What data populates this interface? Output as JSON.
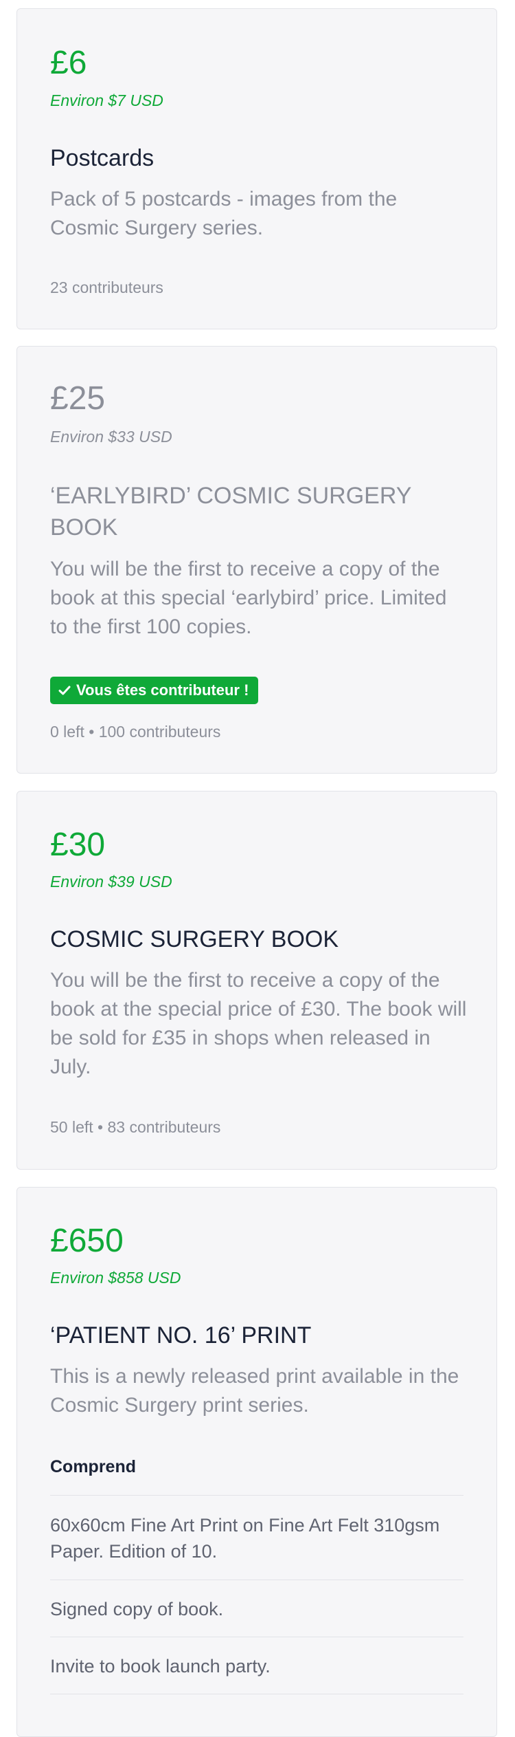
{
  "rewards": [
    {
      "price": "£6",
      "usd": "Environ $7 USD",
      "title": "Postcards",
      "description": "Pack of 5 postcards - images from the Cosmic Surgery series.",
      "meta": "23 contributeurs"
    },
    {
      "price": "£25",
      "usd": "Environ $33 USD",
      "title": "‘EARLYBIRD’ COSMIC SURGERY BOOK",
      "description": "You will be the first to receive a copy of the book at this special ‘earlybird’ price. Limited to the first 100 copies.",
      "badge": "Vous êtes contributeur !",
      "badge_icon": "check-icon",
      "meta": "0 left • 100 contributeurs"
    },
    {
      "price": "£30",
      "usd": "Environ $39 USD",
      "title": "COSMIC SURGERY BOOK",
      "description": "You will be the first to receive a copy of the book at the special price of £30. The book will be sold for £35 in shops when released in July.",
      "meta": "50 left • 83 contributeurs"
    },
    {
      "price": "£650",
      "usd": "Environ $858 USD",
      "title": "‘PATIENT NO. 16’ PRINT",
      "description": "This is a newly released print available in the Cosmic Surgery print series.",
      "includes_label": "Comprend",
      "includes": [
        "60x60cm Fine Art Print on Fine Art Felt 310gsm Paper. Edition of 10.",
        "Signed copy of book.",
        "Invite to book launch party."
      ]
    }
  ],
  "colors": {
    "accent": "#0fa938",
    "heading": "#1b2337",
    "muted": "#8c8f99",
    "card_bg": "#f6f6f8",
    "border": "#e2e3e8"
  }
}
